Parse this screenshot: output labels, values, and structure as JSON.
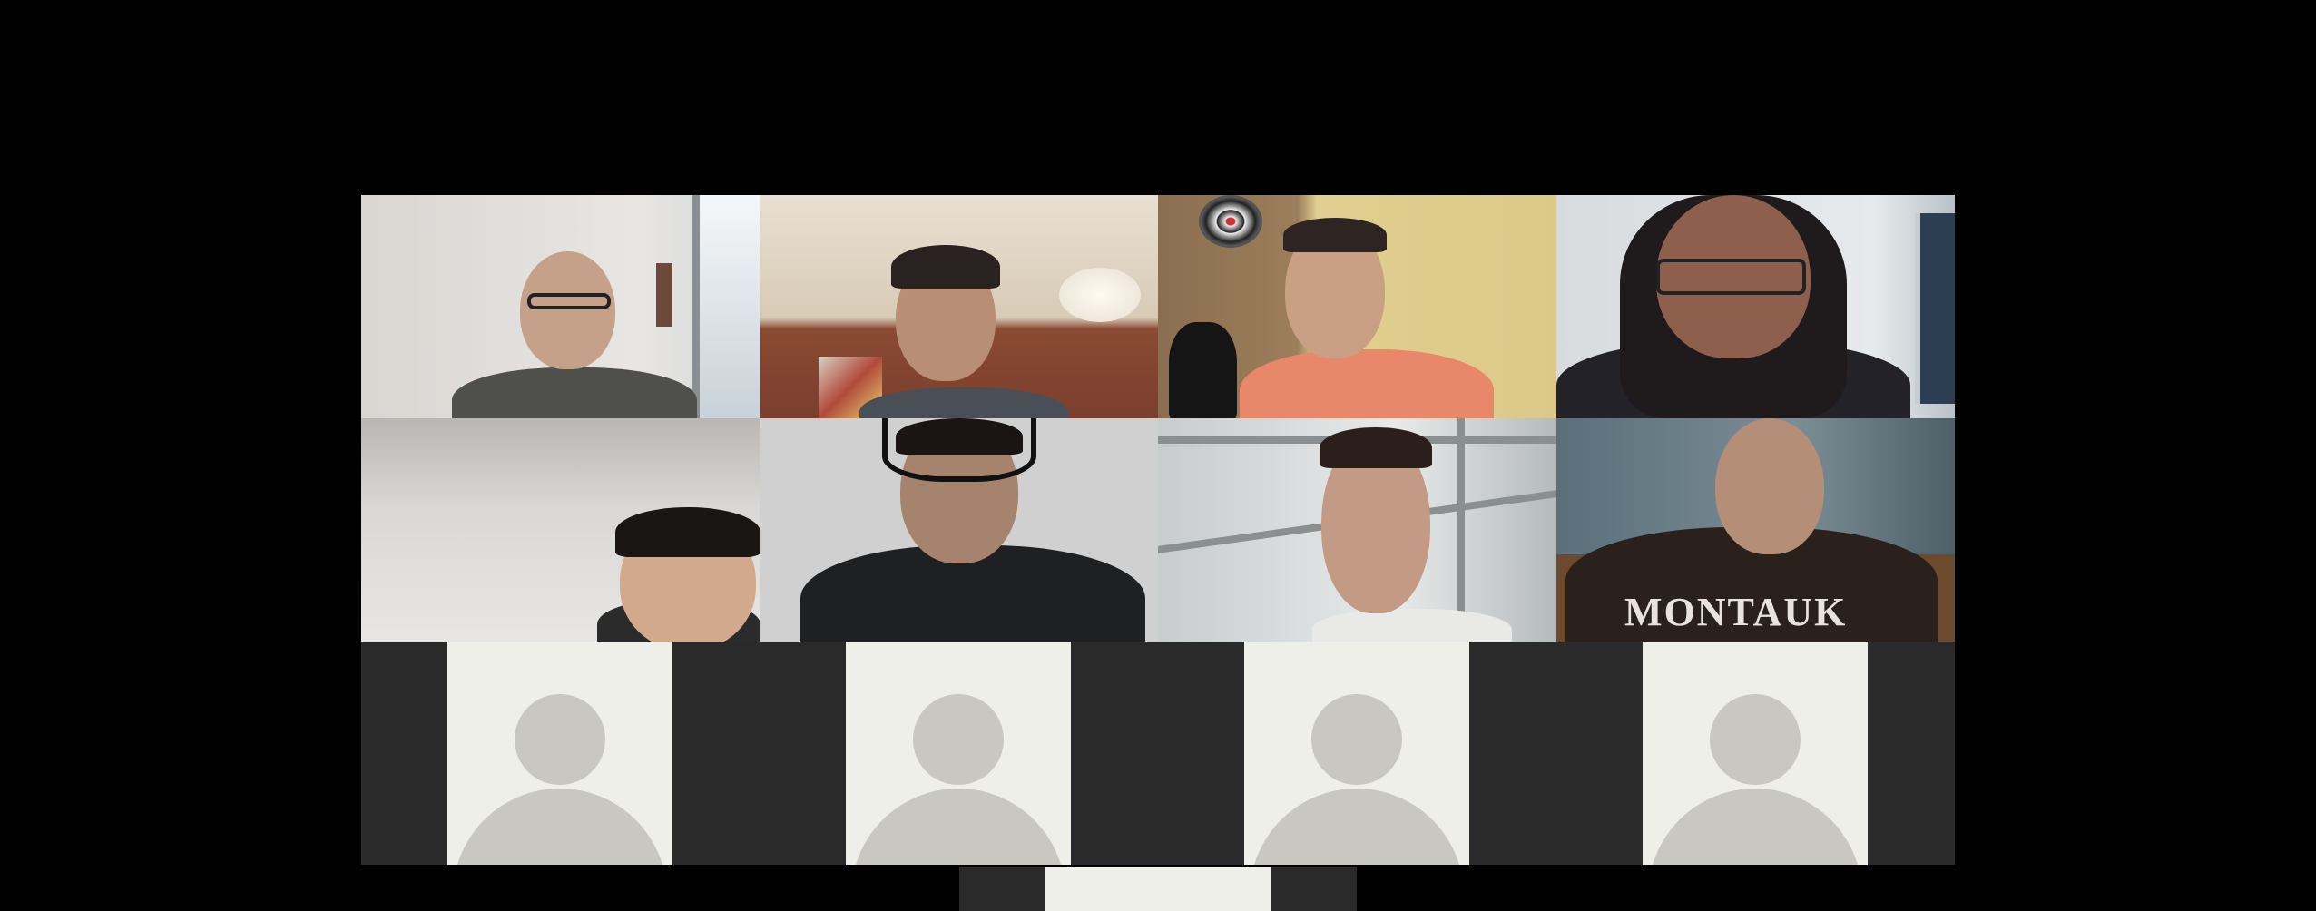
{
  "meeting": {
    "participants": [
      {
        "slot": 1,
        "video": true
      },
      {
        "slot": 2,
        "video": true
      },
      {
        "slot": 3,
        "video": true
      },
      {
        "slot": 4,
        "video": true
      },
      {
        "slot": 5,
        "video": true
      },
      {
        "slot": 6,
        "video": true
      },
      {
        "slot": 7,
        "video": true
      },
      {
        "slot": 8,
        "video": true,
        "shirt_text": "MONTAUK"
      },
      {
        "slot": 9,
        "video": false
      },
      {
        "slot": 10,
        "video": false
      },
      {
        "slot": 11,
        "video": false
      },
      {
        "slot": 12,
        "video": false
      },
      {
        "slot": 13,
        "video": false
      }
    ]
  },
  "colors": {
    "background": "#000000",
    "placeholder_tile": "#2a2a2a",
    "placeholder_card": "#efefea",
    "avatar_silhouette": "#c8c8c0"
  },
  "icons": {
    "avatar": "default-avatar-icon"
  }
}
